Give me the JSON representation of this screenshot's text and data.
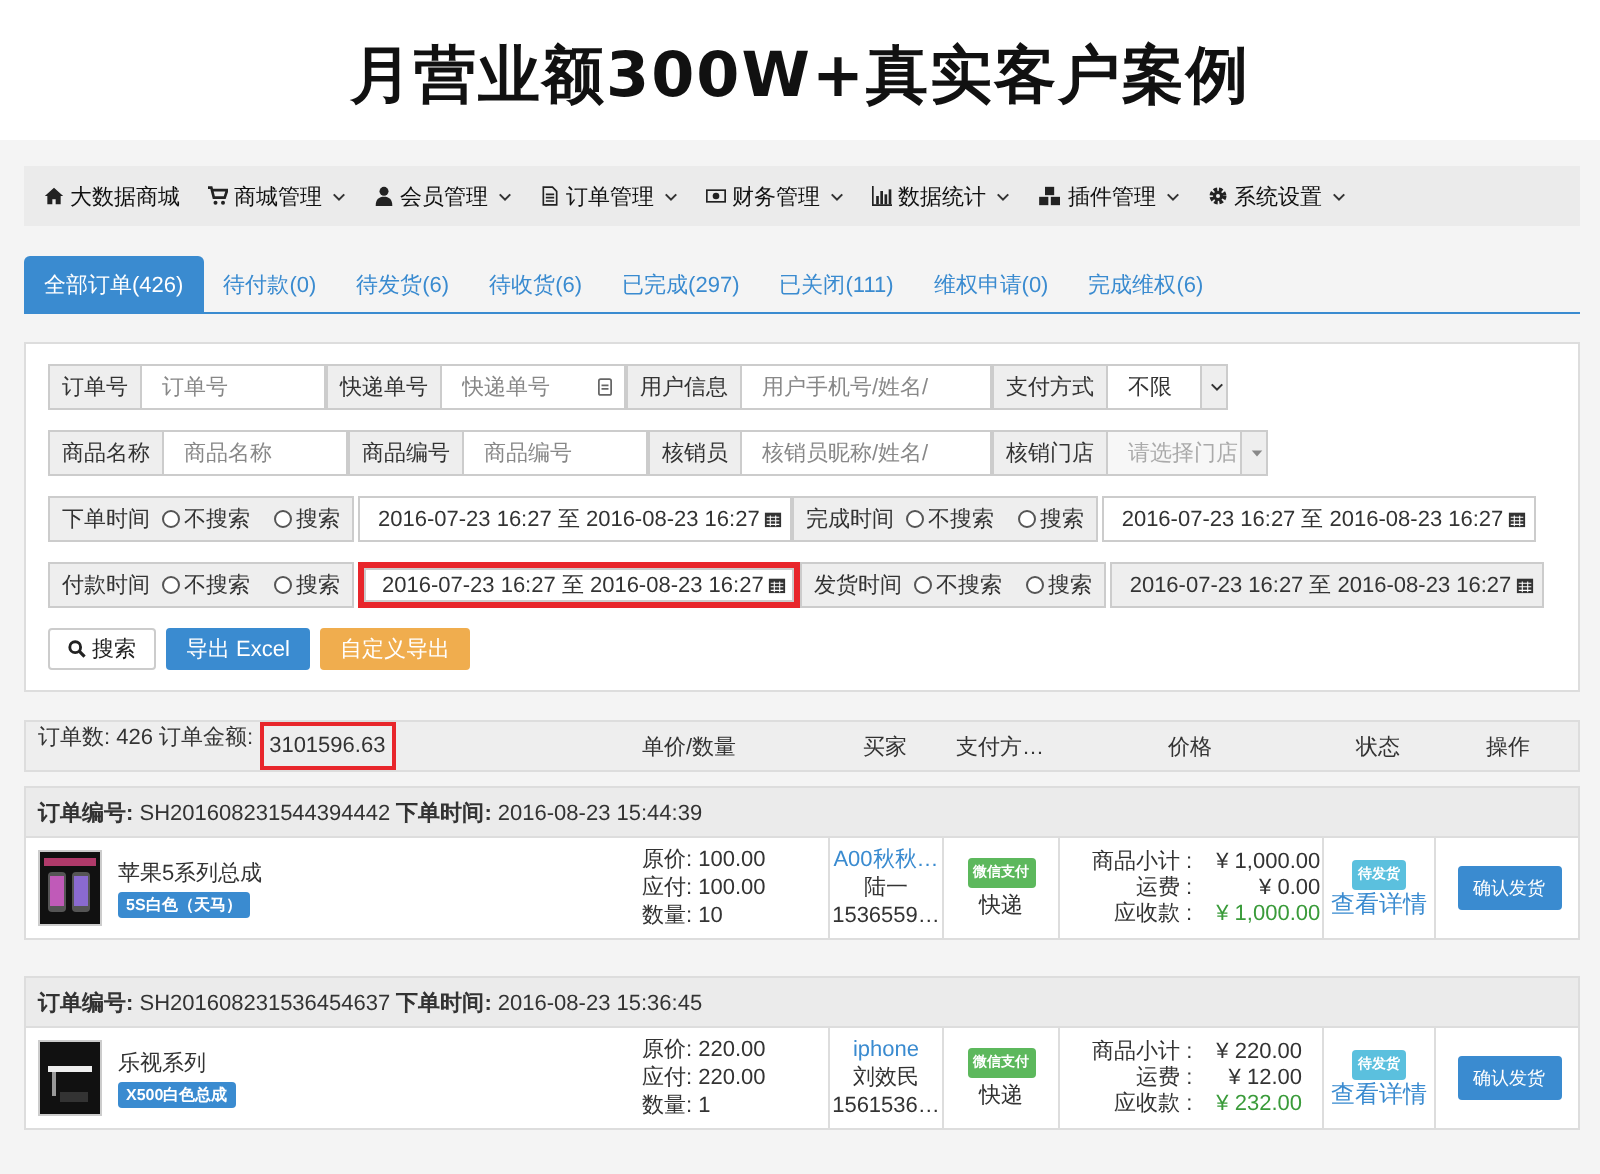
{
  "banner_title": "月营业额300W+真实客户案例",
  "nav": [
    {
      "kind": "home",
      "label": "大数据商城",
      "caret": false
    },
    {
      "kind": "cart",
      "label": "商城管理",
      "caret": true
    },
    {
      "kind": "user",
      "label": "会员管理",
      "caret": true
    },
    {
      "kind": "file",
      "label": "订单管理",
      "caret": true
    },
    {
      "kind": "money",
      "label": "财务管理",
      "caret": true
    },
    {
      "kind": "chart",
      "label": "数据统计",
      "caret": true
    },
    {
      "kind": "cubes",
      "label": "插件管理",
      "caret": true
    },
    {
      "kind": "gear",
      "label": "系统设置",
      "caret": true
    }
  ],
  "tabs": [
    {
      "label": "全部订单(426)",
      "selected": true
    },
    {
      "label": "待付款(0)",
      "selected": false
    },
    {
      "label": "待发货(6)",
      "selected": false
    },
    {
      "label": "待收货(6)",
      "selected": false
    },
    {
      "label": "已完成(297)",
      "selected": false
    },
    {
      "label": "已关闭(111)",
      "selected": false
    },
    {
      "label": "维权申请(0)",
      "selected": false
    },
    {
      "label": "完成维权(6)",
      "selected": false
    }
  ],
  "filter_rows": [
    {
      "kind": "fields",
      "items": [
        {
          "kind": "text",
          "label": "订单号",
          "placeholder": "订单号",
          "has_icon": false
        },
        {
          "kind": "text",
          "label": "快递单号",
          "placeholder": "快递单号",
          "has_icon": true
        },
        {
          "kind": "text",
          "label": "用户信息",
          "placeholder": "用户手机号/姓名/",
          "has_icon": false
        },
        {
          "kind": "select",
          "label": "支付方式",
          "value": "不限",
          "disabled": false
        }
      ]
    },
    {
      "kind": "fields",
      "items": [
        {
          "kind": "text",
          "label": "商品名称",
          "placeholder": "商品名称",
          "has_icon": false
        },
        {
          "kind": "text",
          "label": "商品编号",
          "placeholder": "商品编号",
          "has_icon": false
        },
        {
          "kind": "text",
          "label": "核销员",
          "placeholder": "核销员昵称/姓名/",
          "has_icon": false
        },
        {
          "kind": "select",
          "label": "核销门店",
          "value": "请选择门店",
          "disabled": true
        }
      ]
    },
    {
      "kind": "dates",
      "items": [
        {
          "label": "下单时间",
          "options": [
            {
              "label": "不搜索",
              "selected": false
            },
            {
              "label": "搜索",
              "selected": false
            }
          ],
          "value": "2016-07-23 16:27 至 2016-08-23 16:27",
          "highlighted": false,
          "disabled": false
        },
        {
          "label": "完成时间",
          "options": [
            {
              "label": "不搜索",
              "selected": false
            },
            {
              "label": "搜索",
              "selected": false
            }
          ],
          "value": "2016-07-23 16:27 至 2016-08-23 16:27",
          "highlighted": false,
          "disabled": false
        }
      ]
    },
    {
      "kind": "dates",
      "items": [
        {
          "label": "付款时间",
          "options": [
            {
              "label": "不搜索",
              "selected": false
            },
            {
              "label": "搜索",
              "selected": false
            }
          ],
          "value": "2016-07-23 16:27 至 2016-08-23 16:27",
          "highlighted": true,
          "disabled": false
        },
        {
          "label": "发货时间",
          "options": [
            {
              "label": "不搜索",
              "selected": false
            },
            {
              "label": "搜索",
              "selected": false
            }
          ],
          "value": "2016-07-23 16:27 至 2016-08-23 16:27",
          "highlighted": false,
          "disabled": true
        }
      ]
    }
  ],
  "buttons": [
    {
      "kind": "search",
      "label": "搜索"
    },
    {
      "kind": "primary",
      "label": "导出 Excel"
    },
    {
      "kind": "warning",
      "label": "自定义导出"
    }
  ],
  "summary": {
    "text": "订单数: 426 订单金额:",
    "amount": "3101596.63",
    "highlighted": true
  },
  "columns": [
    "单价/数量",
    "买家",
    "支付方…",
    "价格",
    "状态",
    "操作"
  ],
  "orders": [
    {
      "header": "**订单编号:** SH201608231544394442 **下单时间:** 2016-08-23 15:44:39",
      "product": {
        "name": "苹果5系列总成",
        "tag": "5S白色（天马）"
      },
      "prices": [
        "原价: 100.00",
        "应付: 100.00",
        "数量: 10"
      ],
      "buyer": [
        "A00秋秋…",
        "陆一",
        "1536559…"
      ],
      "payment": "微信支付",
      "shipping": "快递",
      "totals": [
        {
          "label": "商品小计 :",
          "value": "¥ 1,000.00"
        },
        {
          "label": "运费 :",
          "value": "¥ 0.00"
        },
        {
          "label": "应收款 :",
          "value": "¥ 1,000.00"
        }
      ],
      "status": "待发货",
      "detail": "查看详情",
      "action": "确认发货"
    },
    {
      "header": "**订单编号:** SH201608231536454637 **下单时间:** 2016-08-23 15:36:45",
      "product": {
        "name": "乐视系列",
        "tag": "X500白色总成"
      },
      "prices": [
        "原价: 220.00",
        "应付: 220.00",
        "数量: 1"
      ],
      "buyer": [
        "iphone",
        "刘效民",
        "1561536…"
      ],
      "payment": "微信支付",
      "shipping": "快递",
      "totals": [
        {
          "label": "商品小计 :",
          "value": "¥ 220.00"
        },
        {
          "label": "运费 :",
          "value": "¥ 12.00"
        },
        {
          "label": "应收款 :",
          "value": "¥ 232.00"
        }
      ],
      "status": "待发货",
      "detail": "查看详情",
      "action": "确认发货"
    }
  ]
}
